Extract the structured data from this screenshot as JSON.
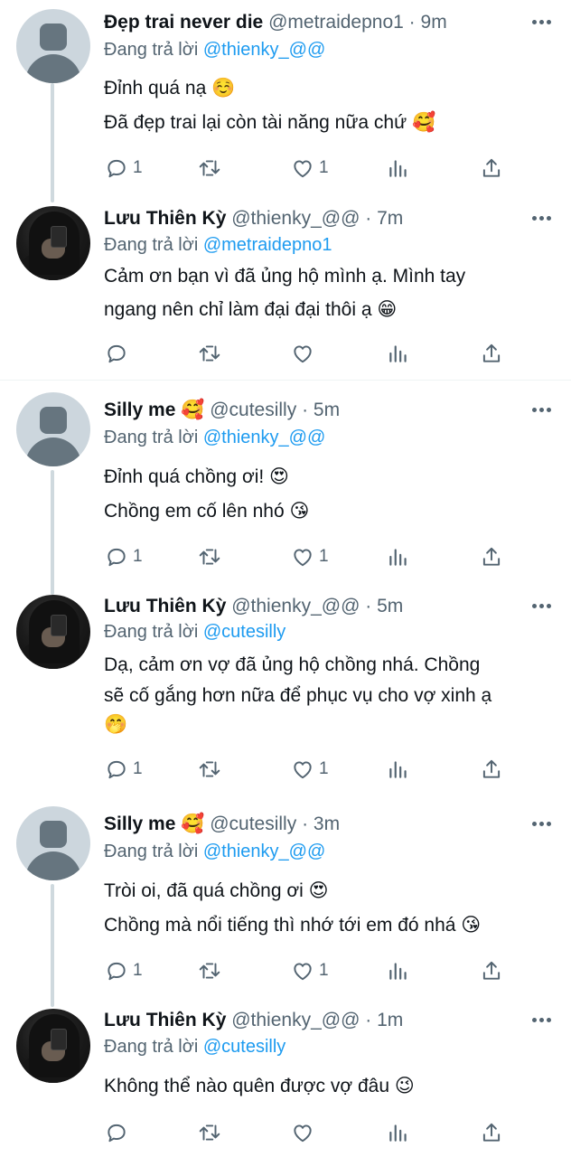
{
  "tweets": [
    {
      "name": "Đẹp trai never die",
      "handle": "@metraidepno1",
      "dot": "·",
      "time": "9m",
      "reply_label": "Đang trả lời",
      "reply_to": "@thienky_@@",
      "lines": [
        "Đỉnh quá nạ ☺️",
        "Đã đẹp trai lại còn tài năng nữa chứ 🥰"
      ],
      "reply_count": "1",
      "like_count": "1",
      "avatar": "default"
    },
    {
      "name": "Lưu Thiên Kỳ",
      "handle": "@thienky_@@",
      "dot": "·",
      "time": "7m",
      "reply_label": "Đang trả lời",
      "reply_to": "@metraidepno1",
      "lines": [
        "Cảm ơn bạn vì đã ủng hộ mình ạ. Mình tay",
        "ngang nên chỉ làm đại đại thôi ạ 😁"
      ],
      "reply_count": "",
      "like_count": "",
      "avatar": "photo"
    },
    {
      "name": "Silly me 🥰",
      "handle": "@cutesilly",
      "dot": "·",
      "time": "5m",
      "reply_label": "Đang trả lời",
      "reply_to": "@thienky_@@",
      "lines": [
        "Đỉnh quá chồng ơi! 😍",
        "Chồng em cố lên nhó 😘"
      ],
      "reply_count": "1",
      "like_count": "1",
      "avatar": "default"
    },
    {
      "name": "Lưu Thiên Kỳ",
      "handle": "@thienky_@@",
      "dot": "·",
      "time": "5m",
      "reply_label": "Đang trả lời",
      "reply_to": "@cutesilly",
      "lines": [
        "Dạ, cảm ơn vợ đã ủng hộ chồng nhá. Chồng",
        "sẽ cố gắng hơn nữa để phục vụ cho vợ xinh ạ",
        "🤭"
      ],
      "reply_count": "1",
      "like_count": "1",
      "avatar": "photo"
    },
    {
      "name": "Silly me 🥰",
      "handle": "@cutesilly",
      "dot": "·",
      "time": "3m",
      "reply_label": "Đang trả lời",
      "reply_to": "@thienky_@@",
      "lines": [
        "Tròi oi, đã quá chồng ơi 😍",
        "Chồng mà nổi tiếng thì nhớ tới em đó nhá 😘"
      ],
      "reply_count": "1",
      "like_count": "1",
      "avatar": "default"
    },
    {
      "name": "Lưu Thiên Kỳ",
      "handle": "@thienky_@@",
      "dot": "·",
      "time": "1m",
      "reply_label": "Đang trả lời",
      "reply_to": "@cutesilly",
      "lines": [
        "Không thể nào quên được vợ đâu 😉"
      ],
      "reply_count": "",
      "like_count": "",
      "avatar": "photo"
    }
  ],
  "icons": {
    "reply": "reply-icon",
    "retweet": "retweet-icon",
    "like": "like-icon",
    "views": "analytics-icon",
    "share": "share-icon",
    "more": "more-icon"
  },
  "colors": {
    "link": "#1d9bf0",
    "muted": "#536471",
    "thread_line": "#cfd9de",
    "avatar_bg": "#ccd6dd",
    "avatar_fg": "#66757f"
  }
}
